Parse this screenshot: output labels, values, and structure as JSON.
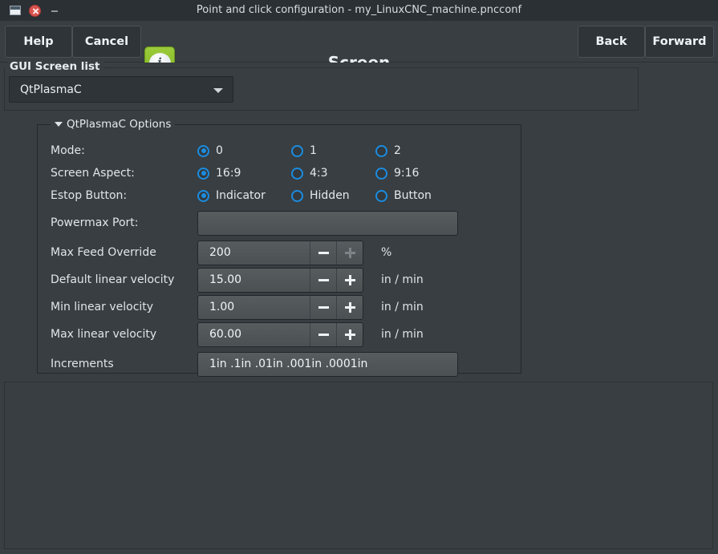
{
  "window": {
    "title": "Point and click configuration - my_LinuxCNC_machine.pncconf",
    "icons": {
      "window_icon": "window-icon",
      "close": "close-icon",
      "minimize": "minimize-icon"
    }
  },
  "toolbar": {
    "help_label": "Help",
    "cancel_label": "Cancel",
    "info_icon": "info-icon",
    "info_glyph": "i",
    "page_title": "Screen",
    "back_label": "Back",
    "forward_label": "Forward"
  },
  "gui_screen_list": {
    "group_label": "GUI Screen list",
    "combo_value": "QtPlasmaC",
    "combo_arrow": "chevron-down-icon"
  },
  "options": {
    "group_label": "QtPlasmaC Options",
    "collapse_icon": "triangle-down-icon",
    "rows": {
      "mode": {
        "label": "Mode:",
        "choices": [
          {
            "label": "0",
            "selected": true
          },
          {
            "label": "1",
            "selected": false
          },
          {
            "label": "2",
            "selected": false
          }
        ]
      },
      "screen_aspect": {
        "label": "Screen Aspect:",
        "choices": [
          {
            "label": "16:9",
            "selected": true
          },
          {
            "label": "4:3",
            "selected": false
          },
          {
            "label": "9:16",
            "selected": false
          }
        ]
      },
      "estop_button": {
        "label": "Estop Button:",
        "choices": [
          {
            "label": "Indicator",
            "selected": true
          },
          {
            "label": "Hidden",
            "selected": false
          },
          {
            "label": "Button",
            "selected": false
          }
        ]
      },
      "powermax_port": {
        "label": "Powermax Port:",
        "value": "",
        "placeholder": ""
      },
      "max_feed_override": {
        "label": "Max Feed Override",
        "value": "200",
        "unit": "%",
        "minus_enabled": true,
        "plus_enabled": false
      },
      "default_linear_velocity": {
        "label": "Default linear velocity",
        "value": "15.00",
        "unit": "in / min",
        "minus_enabled": true,
        "plus_enabled": true
      },
      "min_linear_velocity": {
        "label": "Min linear velocity",
        "value": "1.00",
        "unit": "in / min",
        "minus_enabled": true,
        "plus_enabled": true
      },
      "max_linear_velocity": {
        "label": "Max linear velocity",
        "value": "60.00",
        "unit": "in / min",
        "minus_enabled": true,
        "plus_enabled": true
      },
      "increments": {
        "label": "Increments",
        "value": "1in .1in .01in .001in .0001in"
      }
    }
  },
  "colors": {
    "window_bg": "#383e41",
    "titlebar_bg": "#2b3035",
    "accent_blue": "#1b8ce0",
    "info_green": "#8dbf2d",
    "close_red": "#d9534f",
    "field_bg": "#545a5c"
  }
}
